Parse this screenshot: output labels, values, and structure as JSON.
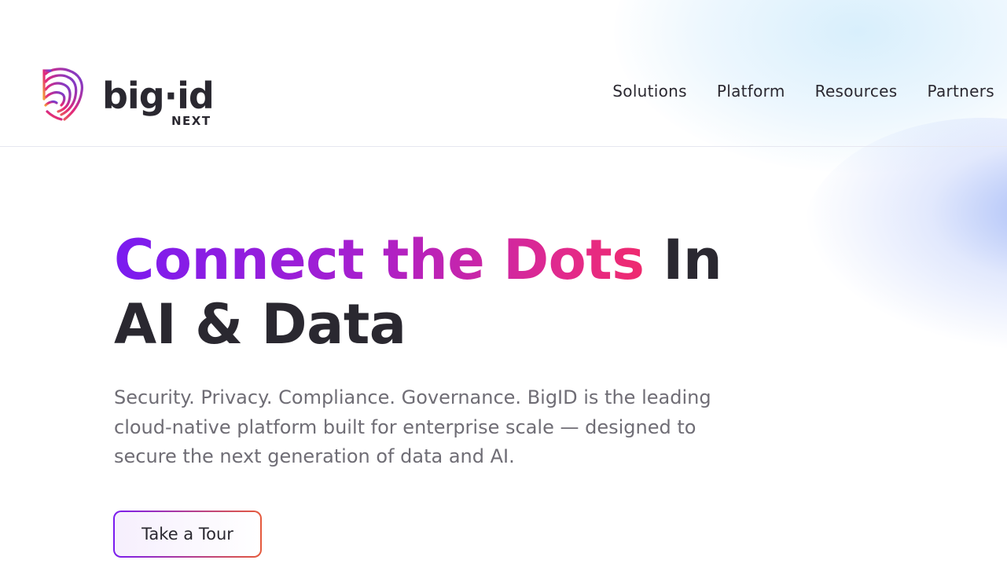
{
  "brand": {
    "name": "big·id",
    "sub": "NEXT",
    "colors": {
      "orange": "#f07a3c",
      "magenta": "#e2287a",
      "purple": "#7a1cf0",
      "dark": "#2a2830"
    }
  },
  "nav": {
    "items": [
      {
        "label": "Solutions"
      },
      {
        "label": "Platform"
      },
      {
        "label": "Resources"
      },
      {
        "label": "Partners"
      }
    ]
  },
  "hero": {
    "headline_highlight": "Connect the Dots",
    "headline_rest_1": " In",
    "headline_line2": "AI & Data",
    "subtitle": "Security. Privacy. Compliance. Governance. BigID is the leading cloud-native platform built for enterprise scale — designed to secure the next generation of data and AI.",
    "cta_label": "Take a Tour"
  }
}
